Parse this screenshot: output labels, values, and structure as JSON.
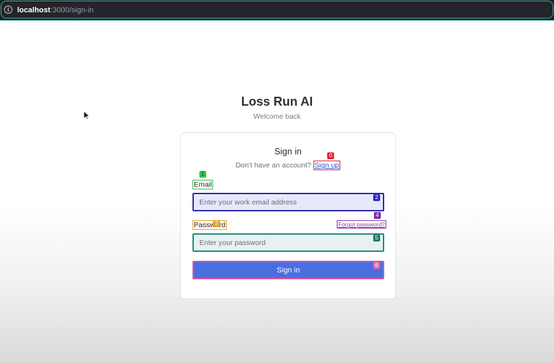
{
  "browser": {
    "url_host": "localhost",
    "url_path": ":3000/sign-in",
    "info_icon": "i"
  },
  "app": {
    "title": "Loss Run AI",
    "subtitle": "Welcome back"
  },
  "card": {
    "title": "Sign in",
    "signup_prompt": "Don't have an account?",
    "signup_link": "Sign up",
    "email_label": "Email",
    "email_placeholder": "Enter your work email address",
    "password_label": "Password",
    "forgot_link": "Forgot password?",
    "password_placeholder": "Enter your password",
    "submit_label": "Sign in"
  },
  "markers": [
    "0",
    "1",
    "2",
    "3",
    "4",
    "5",
    "6"
  ],
  "colors": {
    "primary_button": "#4a6ee0",
    "link": "#4a4cc7",
    "browser_bar": "#1e1f23"
  }
}
